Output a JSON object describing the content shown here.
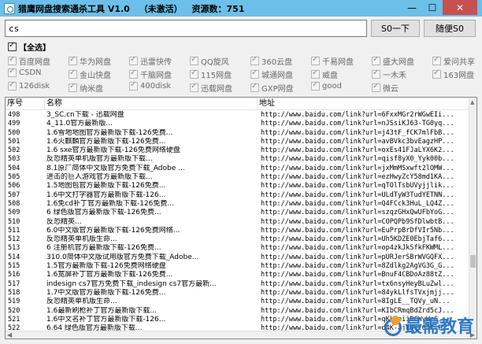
{
  "window": {
    "title": "猎鹰网盘搜索通杀工具 V1.0",
    "status": "（未激活）",
    "resource_label": "资源数：751",
    "controls": {
      "minimize": "—",
      "maximize": "☐",
      "close": "✕"
    }
  },
  "search": {
    "value": "cs",
    "search_button": "S0一下",
    "random_button": "随便S0"
  },
  "filters": {
    "select_all": "【全选】",
    "options": [
      [
        "百度网盘",
        "华为网盘",
        "迅雷快传",
        "QQ旋风",
        "360云盘",
        "千易网盘",
        "盛大网盘",
        "爱问共享"
      ],
      [
        "CSDN",
        "金山快盘",
        "千脑网盘",
        "115网盘",
        "城通网盘",
        "威盘",
        "一木禾",
        "163网盘"
      ],
      [
        "126disk",
        "纳米盘",
        "400disk",
        "迅载网盘",
        "GXP网盘",
        "good",
        "微云"
      ]
    ]
  },
  "table": {
    "columns": [
      "序号",
      "名称",
      "地址"
    ],
    "rows": [
      [
        "498",
        "3_SC.cn下载 - 迅载网盘",
        "http://www.baidu.com/link?url=6FxxMGr2rWGwEIi..."
      ],
      [
        "499",
        "4_11.0官方最新版...",
        "http://www.baidu.com/link?url=nJSsiKJ63-TG0yq..."
      ],
      [
        "500",
        "1.6雪地地图官方最新版下载-126免费...",
        "http://www.baidu.com/link?url=j43tF_fCK7mlFbB..."
      ],
      [
        "501",
        "1.6火麒麟官方最新版下载-126免费...",
        "http://www.baidu.com/link?url=avBVkc3bvEagzHP..."
      ],
      [
        "502",
        "1.6 sxe官方最新版下载-126免费网络硬盘",
        "http://www.baidu.com/link?url=oxEs41FJaLYX6K2..."
      ],
      [
        "503",
        "反恐精英单机版官方最新版下载...",
        "http://www.baidu.com/link?url=qisf8yX0_Yyk00b..."
      ],
      [
        "504",
        "8.1原厂简体中文版官方免费下载_Adobe ...",
        "http://www.baidu.com/link?url=jxMmMSxwft2lOMW..."
      ],
      [
        "505",
        "进击的巨人游戏官方最新版下载...",
        "http://www.baidu.com/link?url=ezHwyZcY58md1KA..."
      ],
      [
        "506",
        "1.5地图包官方最新版下载-126免费...",
        "http://www.baidu.com/link?url=qTOlTsbUVyjjlik..."
      ],
      [
        "507",
        "1.6中文打字器官方最新版下载-126...",
        "http://www.baidu.com/link?url=ULdTyW3TudYETNN..."
      ],
      [
        "508",
        "1.6免cd补丁官方最新版下载-126免费...",
        "http://www.baidu.com/link?url=Q4FCck3HuL_LQ4Z..."
      ],
      [
        "509",
        "6 绿色版官方最新版下载-126免费...",
        "http://www.baidu.com/link?url=szqzGHxQwUFbYoG..."
      ],
      [
        "510",
        "反恐精英...",
        "http://www.baidu.com/link?url=COPQPb9SfDlwbtB..."
      ],
      [
        "511",
        "6.0中文版官方最新版下载-126免费网络...",
        "http://www.baidu.com/link?url=EuPrpBrDfVIr5Nb..."
      ],
      [
        "512",
        "反恐精英单机版生命...",
        "http://www.baidu.com/link?url=Uh5KDZE0EbjTaf6..."
      ],
      [
        "513",
        "6 注册机官方最新版下载-126免费...",
        "http://www.baidu.com/link?url=op4zkJkSfkFKWML..."
      ],
      [
        "514",
        "310.0简体中文版试用版官方免费下载_Adobe...",
        "http://www.baidu.com/link?url=pURJerSBrWVGQFX..."
      ],
      [
        "515",
        "1.5官方最新版下载-126免费网络硬盘",
        "http://www.baidu.com/link?url=8Zdlkg2AgVG3G_G..."
      ],
      [
        "516",
        "1.6宽屏补丁官方最新版下载-126免费...",
        "http://www.baidu.com/link?url=BnuF4CBDoAz88tZ..."
      ],
      [
        "517",
        "indesign cs7官方免费下载_indesign cs7官方最新...",
        "http://www.baidu.com/link?url=tx6nsyHeyBLuZwl..."
      ],
      [
        "518",
        "1.7中文版官方最新版下载-126免费...",
        "http://www.baidu.com/link?url=84ykLlfsTVxjmjj..."
      ],
      [
        "519",
        "反恐精英单机版生命...",
        "http://www.baidu.com/link?url=8IgLE__TQVy_uN..."
      ],
      [
        "520",
        "1.6最新刷枪补丁官方最新版下载...",
        "http://www.baidu.com/link?url=KIbCRmqBdZrd5cJ..."
      ],
      [
        "521",
        "1.6中文名补丁官方最新版下载-126...",
        "http://www.baidu.com/link?url=qKk1eiiRCWvWcG..."
      ],
      [
        "522",
        "6.64 绿色版官方最新版下载...",
        "http://www.baidu.com/link?url=d4K-ajLBkY03T-P..."
      ]
    ]
  },
  "watermark": {
    "text": "最需教育"
  }
}
